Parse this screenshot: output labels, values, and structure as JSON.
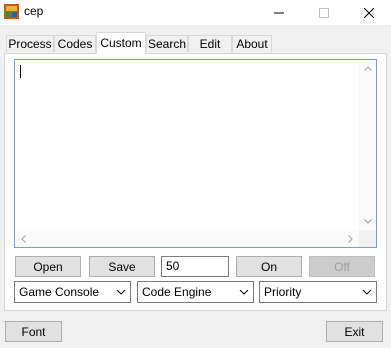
{
  "window": {
    "title": "cep",
    "minimize_icon": "minimize-icon",
    "maximize_icon": "maximize-icon",
    "close_icon": "close-icon"
  },
  "tabs": [
    {
      "label": "Process"
    },
    {
      "label": "Codes"
    },
    {
      "label": "Custom"
    },
    {
      "label": "Search"
    },
    {
      "label": "Edit"
    },
    {
      "label": "About"
    }
  ],
  "active_tab": "Custom",
  "editor": {
    "value": ""
  },
  "controls": {
    "open_label": "Open",
    "save_label": "Save",
    "interval_value": "50",
    "on_label": "On",
    "off_label": "Off"
  },
  "selects": {
    "console": "Game Console",
    "engine": "Code Engine",
    "priority": "Priority"
  },
  "footer": {
    "font_label": "Font",
    "exit_label": "Exit"
  },
  "colors": {
    "editor_border": "#7a9ccc",
    "window_bg": "#f0f0f0"
  }
}
